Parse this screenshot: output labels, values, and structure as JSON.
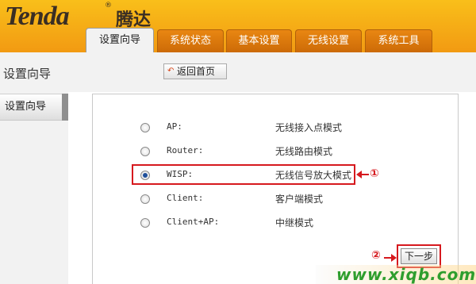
{
  "header": {
    "logo_text": "Tenda",
    "logo_reg": "®",
    "brand_cn": "腾达",
    "tabs": [
      {
        "label": "设置向导",
        "active": true
      },
      {
        "label": "系统状态",
        "active": false
      },
      {
        "label": "基本设置",
        "active": false
      },
      {
        "label": "无线设置",
        "active": false
      },
      {
        "label": "系统工具",
        "active": false
      }
    ]
  },
  "page": {
    "title": "设置向导",
    "home_button": "返回首页"
  },
  "sidebar": {
    "items": [
      {
        "label": "设置向导"
      }
    ]
  },
  "modes": [
    {
      "name": "AP:",
      "desc": "无线接入点模式",
      "selected": false
    },
    {
      "name": "Router:",
      "desc": "无线路由模式",
      "selected": false
    },
    {
      "name": "WISP:",
      "desc": "无线信号放大模式",
      "selected": true
    },
    {
      "name": "Client:",
      "desc": "客户端模式",
      "selected": false
    },
    {
      "name": "Client+AP:",
      "desc": "中继模式",
      "selected": false
    }
  ],
  "annotations": {
    "marker1": "①",
    "marker2": "②"
  },
  "next_button": "下一步",
  "watermark": "www.xiqb.com",
  "colors": {
    "header_orange": "#f29a12",
    "tab_orange": "#e98712",
    "highlight_red": "#d6191e",
    "radio_selected": "#1f4f9a",
    "watermark_green": "#2e9e2e"
  }
}
